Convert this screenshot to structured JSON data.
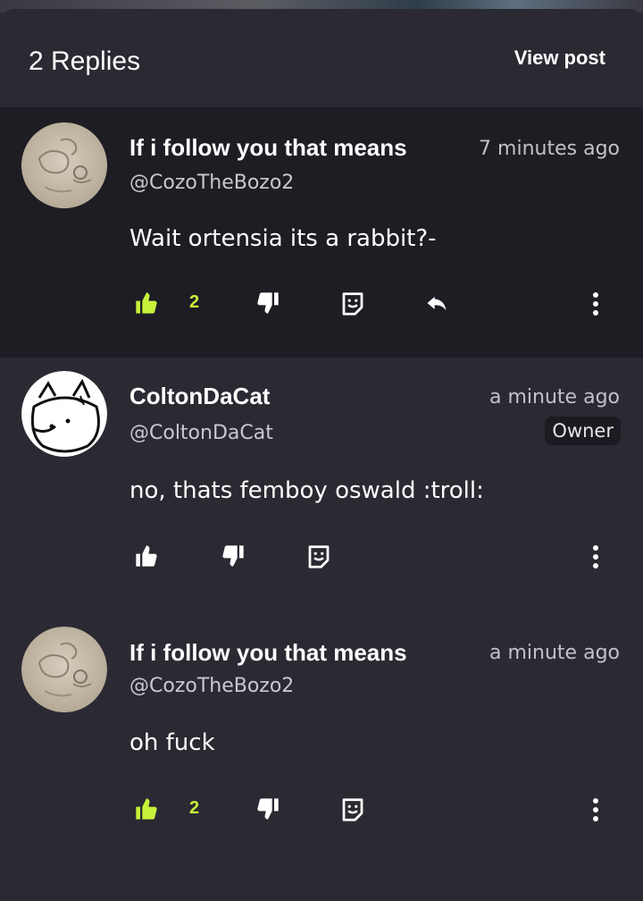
{
  "header": {
    "title": "2 Replies",
    "view_post": "View post"
  },
  "comments": [
    {
      "name": "If i follow you that means",
      "handle": "@CozoTheBozo2",
      "time": "7 minutes ago",
      "text": "Wait ortensia its a rabbit?-",
      "likes": "2",
      "liked": true,
      "badge": "",
      "avatar": "cozo-avatar"
    },
    {
      "name": "ColtonDaCat",
      "handle": "@ColtonDaCat",
      "time": "a minute ago",
      "text": "no, thats femboy oswald :troll:",
      "likes": "",
      "liked": false,
      "badge": "Owner",
      "avatar": "cat-avatar"
    },
    {
      "name": "If i follow you that means",
      "handle": "@CozoTheBozo2",
      "time": "a minute ago",
      "text": "oh fuck",
      "likes": "2",
      "liked": true,
      "badge": "",
      "avatar": "cozo-avatar"
    }
  ],
  "colors": {
    "accent": "#c6f23a",
    "background": "#2b2a33",
    "highlight": "#1e1d24"
  }
}
